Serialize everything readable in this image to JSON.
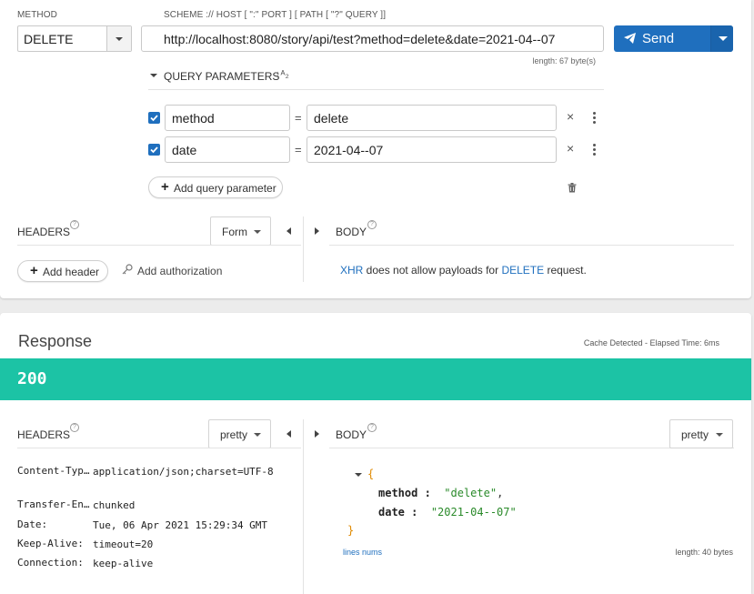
{
  "request": {
    "method_label": "METHOD",
    "method_value": "DELETE",
    "url_label": "SCHEME :// HOST [ \":\" PORT ] [ PATH [ \"?\" QUERY ]]",
    "url_value": "http://localhost:8080/story/api/test?method=delete&date=2021-04--07",
    "length_note": "length: 67 byte(s)",
    "send_label": "Send",
    "query": {
      "title": "QUERY PARAMETERS",
      "sort_glyph": "↓ᴬ₂",
      "params": [
        {
          "checked": true,
          "name": "method",
          "value": "delete"
        },
        {
          "checked": true,
          "name": "date",
          "value": "2021-04--07"
        }
      ],
      "eq": "=",
      "remove_glyph": "×",
      "add_label": "Add query parameter"
    },
    "headers": {
      "title": "HEADERS",
      "mode": "Form",
      "add_label": "Add header",
      "auth_label": "Add authorization"
    },
    "body": {
      "title": "BODY",
      "notice_prefix": "XHR",
      "notice_middle": " does not allow payloads for ",
      "notice_method": "DELETE",
      "notice_suffix": " request."
    }
  },
  "response": {
    "title": "Response",
    "meta": "Cache Detected - Elapsed Time: 6ms",
    "status": "200",
    "status_color": "#1cc3a5",
    "headers": {
      "title": "HEADERS",
      "mode": "pretty",
      "rows": [
        {
          "key": "Content-Typ…",
          "value": "application/json;charset=UTF-8"
        },
        {
          "key": "Transfer-En…",
          "value": "chunked"
        },
        {
          "key": "Date:",
          "value": "Tue, 06 Apr 2021 15:29:34 GMT"
        },
        {
          "key": "Keep-Alive:",
          "value": "timeout=20"
        },
        {
          "key": "Connection:",
          "value": "keep-alive"
        }
      ]
    },
    "body": {
      "title": "BODY",
      "mode": "pretty",
      "open_brace": "{",
      "close_brace": "}",
      "fields": [
        {
          "key": "method",
          "value": "\"delete\"",
          "sep": ",",
          "colon": " :"
        },
        {
          "key": "date",
          "value": "\"2021-04--07\"",
          "sep": "",
          "colon": " :"
        }
      ],
      "lines_link": "lines nums",
      "length": "length: 40 bytes"
    }
  },
  "colors": {
    "accent": "#1f6fbe",
    "success": "#1cc3a5"
  }
}
